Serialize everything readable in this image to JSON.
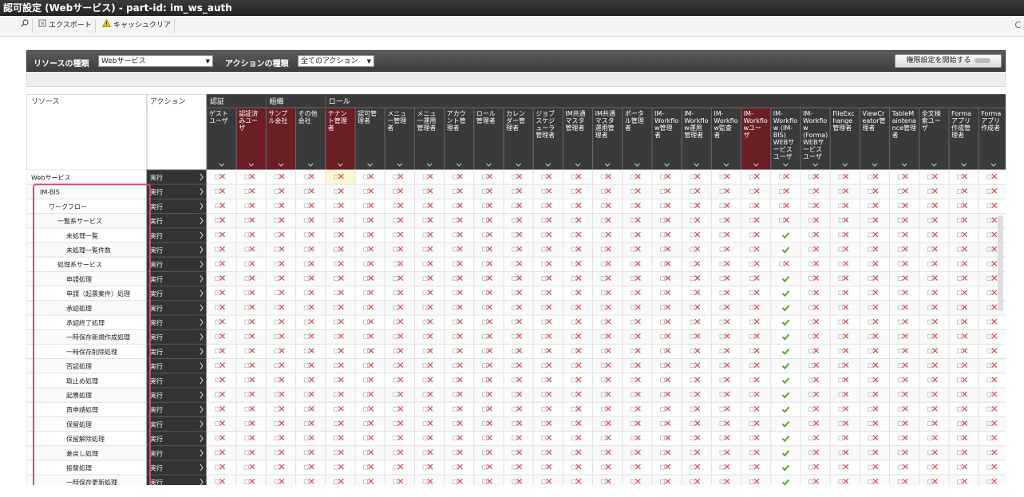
{
  "window": {
    "title": "認可設定 (Webサービス) - part-id: im_ws_auth"
  },
  "toolbar": {
    "search_icon": "magnifier-icon",
    "export_label": "エクスポート",
    "cache_clear_label": "キャッシュクリア",
    "refresh_label": "C"
  },
  "filter": {
    "resource_type_label": "リソースの種類",
    "resource_type_value": "Webサービス",
    "action_type_label": "アクションの種類",
    "action_type_value": "全てのアクション",
    "start_button_label": "権限設定を開始する"
  },
  "grid": {
    "resource_header": "リソース",
    "action_header": "アクション",
    "groups": [
      {
        "label": "認証",
        "span": 2
      },
      {
        "label": "組織",
        "span": 2
      },
      {
        "label": "ロール",
        "span": 23
      }
    ],
    "columns": [
      {
        "label": "ゲスト\nユーザ",
        "dark": false
      },
      {
        "label": "認証済\nみユー\nザ",
        "dark": true
      },
      {
        "label": "サンプ\nル会社",
        "dark": true
      },
      {
        "label": "その他\n会社",
        "dark": false
      },
      {
        "label": "テナン\nト管理\n者",
        "dark": true
      },
      {
        "label": "認可管\n理者",
        "dark": false
      },
      {
        "label": "メニュ\n一管理\n者",
        "dark": false
      },
      {
        "label": "メニュ\n一運用\n管理者",
        "dark": false
      },
      {
        "label": "アカウ\nント管\n理者",
        "dark": false
      },
      {
        "label": "ロール\n管理者",
        "dark": false
      },
      {
        "label": "カレン\nダー管\n理者",
        "dark": false
      },
      {
        "label": "ジョブ\nスケジ\nューラ\n管理者",
        "dark": false
      },
      {
        "label": "IM共通\nマスタ\n管理者",
        "dark": false
      },
      {
        "label": "IM共通\nマスタ\n運用管\n理者",
        "dark": false
      },
      {
        "label": "ポータ\nル管理\n者",
        "dark": false
      },
      {
        "label": "IM-\nWorkflo\nw管理\n者",
        "dark": false
      },
      {
        "label": "IM-\nWorkflo\nw運用\n管理者",
        "dark": false
      },
      {
        "label": "IM-\nWorkflo\nw監査\n者",
        "dark": false
      },
      {
        "label": "IM-\nWorkflo\nwユー\nザ",
        "dark": true
      },
      {
        "label": "IM-\nWorkflo\nw (IM-\nBIS)\nWEBサ\nービス\nユーザ",
        "dark": false
      },
      {
        "label": "IM-\nWorkflo\nw\n(Forma)\nWEBサ\nービス\nユーザ",
        "dark": false
      },
      {
        "label": "FileExc\nhange\n管理者",
        "dark": false
      },
      {
        "label": "ViewCr\neator管\n理者",
        "dark": false
      },
      {
        "label": "TableM\naintena\nnce管理\n者",
        "dark": false
      },
      {
        "label": "全文検\n索ユー\nザ",
        "dark": false
      },
      {
        "label": "Forma\nアプリ\n作成管\n理者",
        "dark": false
      },
      {
        "label": "Forma\nアプリ\n作成者",
        "dark": false
      }
    ],
    "rows": [
      {
        "resource": "Webサービス",
        "level": 0,
        "action": "実行",
        "checks": []
      },
      {
        "resource": "IM-BIS",
        "level": 1,
        "action": "実行",
        "checks": []
      },
      {
        "resource": "ワークフロー",
        "level": 2,
        "action": "実行",
        "checks": []
      },
      {
        "resource": "一覧系サービス",
        "level": 3,
        "action": "実行",
        "checks": []
      },
      {
        "resource": "未処理一覧",
        "level": 4,
        "action": "実行",
        "checks": [
          19
        ]
      },
      {
        "resource": "未処理一覧件数",
        "level": 4,
        "action": "実行",
        "checks": [
          19
        ]
      },
      {
        "resource": "処理系サービス",
        "level": 3,
        "action": "実行",
        "checks": []
      },
      {
        "resource": "申請処理",
        "level": 4,
        "action": "実行",
        "checks": [
          19
        ]
      },
      {
        "resource": "申請（起票案件）処理",
        "level": 4,
        "action": "実行",
        "checks": [
          19
        ]
      },
      {
        "resource": "承認処理",
        "level": 4,
        "action": "実行",
        "checks": [
          19
        ]
      },
      {
        "resource": "承認終了処理",
        "level": 4,
        "action": "実行",
        "checks": [
          19
        ]
      },
      {
        "resource": "一時保存新規作成処理",
        "level": 4,
        "action": "実行",
        "checks": [
          19
        ]
      },
      {
        "resource": "一時保存削除処理",
        "level": 4,
        "action": "実行",
        "checks": [
          19
        ]
      },
      {
        "resource": "否認処理",
        "level": 4,
        "action": "実行",
        "checks": [
          19
        ]
      },
      {
        "resource": "取止め処理",
        "level": 4,
        "action": "実行",
        "checks": [
          19
        ]
      },
      {
        "resource": "起票処理",
        "level": 4,
        "action": "実行",
        "checks": [
          19
        ]
      },
      {
        "resource": "再申請処理",
        "level": 4,
        "action": "実行",
        "checks": [
          19
        ]
      },
      {
        "resource": "保留処理",
        "level": 4,
        "action": "実行",
        "checks": [
          19
        ]
      },
      {
        "resource": "保留解除処理",
        "level": 4,
        "action": "実行",
        "checks": [
          19
        ]
      },
      {
        "resource": "差戻し処理",
        "level": 4,
        "action": "実行",
        "checks": [
          19
        ]
      },
      {
        "resource": "振替処理",
        "level": 4,
        "action": "実行",
        "checks": [
          19
        ]
      },
      {
        "resource": "一時保存更新処理",
        "level": 4,
        "action": "実行",
        "checks": [
          19
        ]
      }
    ],
    "highlight_cell": {
      "row": 0,
      "col": 4
    }
  },
  "colors": {
    "dark_header": "#3a3a3a",
    "maroon_header": "#6b1f24",
    "highlight_border": "#e0457b",
    "check": "#5aa62b",
    "deny_x": "#d9534f"
  }
}
